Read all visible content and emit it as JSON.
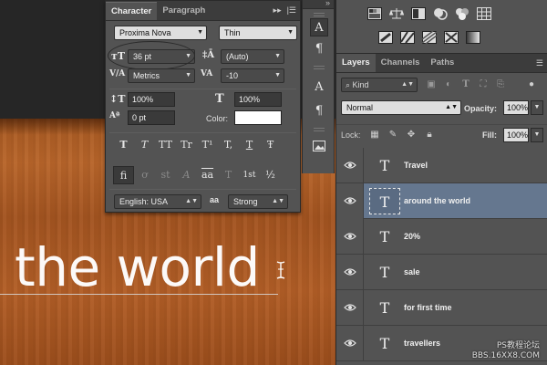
{
  "canvas": {
    "text": "the world"
  },
  "character_panel": {
    "tabs": [
      "Character",
      "Paragraph"
    ],
    "font_family": "Proxima Nova",
    "font_style": "Thin",
    "font_size": "36 pt",
    "leading": "(Auto)",
    "kerning": "Metrics",
    "tracking": "-10",
    "vertical_scale": "100%",
    "horizontal_scale": "100%",
    "baseline_shift": "0 pt",
    "color_label": "Color:",
    "color_value": "#ffffff",
    "type_buttons_row1": [
      "T",
      "T",
      "TT",
      "Tr",
      "T¹",
      "T,",
      "T",
      "Ŧ"
    ],
    "type_buttons_row2": [
      "fi",
      "ơ",
      "st",
      "A",
      "aa",
      "T",
      "1st",
      "½"
    ],
    "language": "English: USA",
    "aa_label": "aa",
    "antialias": "Strong"
  },
  "tool_strip": {
    "buttons": [
      "A",
      "¶",
      "A",
      "¶"
    ]
  },
  "layers_panel": {
    "tabs": [
      "Layers",
      "Channels",
      "Paths"
    ],
    "filter_kind": "Kind",
    "blend_mode": "Normal",
    "opacity_label": "Opacity:",
    "opacity": "100%",
    "lock_label": "Lock:",
    "fill_label": "Fill:",
    "fill": "100%",
    "layers": [
      {
        "name": "Travel",
        "type": "T",
        "selected": false
      },
      {
        "name": "around the world",
        "type": "T",
        "selected": true
      },
      {
        "name": "20%",
        "type": "T",
        "selected": false
      },
      {
        "name": "sale",
        "type": "T",
        "selected": false
      },
      {
        "name": "for first time",
        "type": "T",
        "selected": false
      },
      {
        "name": "travellers",
        "type": "T",
        "selected": false
      }
    ]
  },
  "watermark": {
    "line1": "PS教程论坛",
    "line2": "BBS.16XX8.COM"
  },
  "colors": {
    "panel": "#535353",
    "selected_layer": "#65778f",
    "canvas_wood": "#a85a22"
  }
}
